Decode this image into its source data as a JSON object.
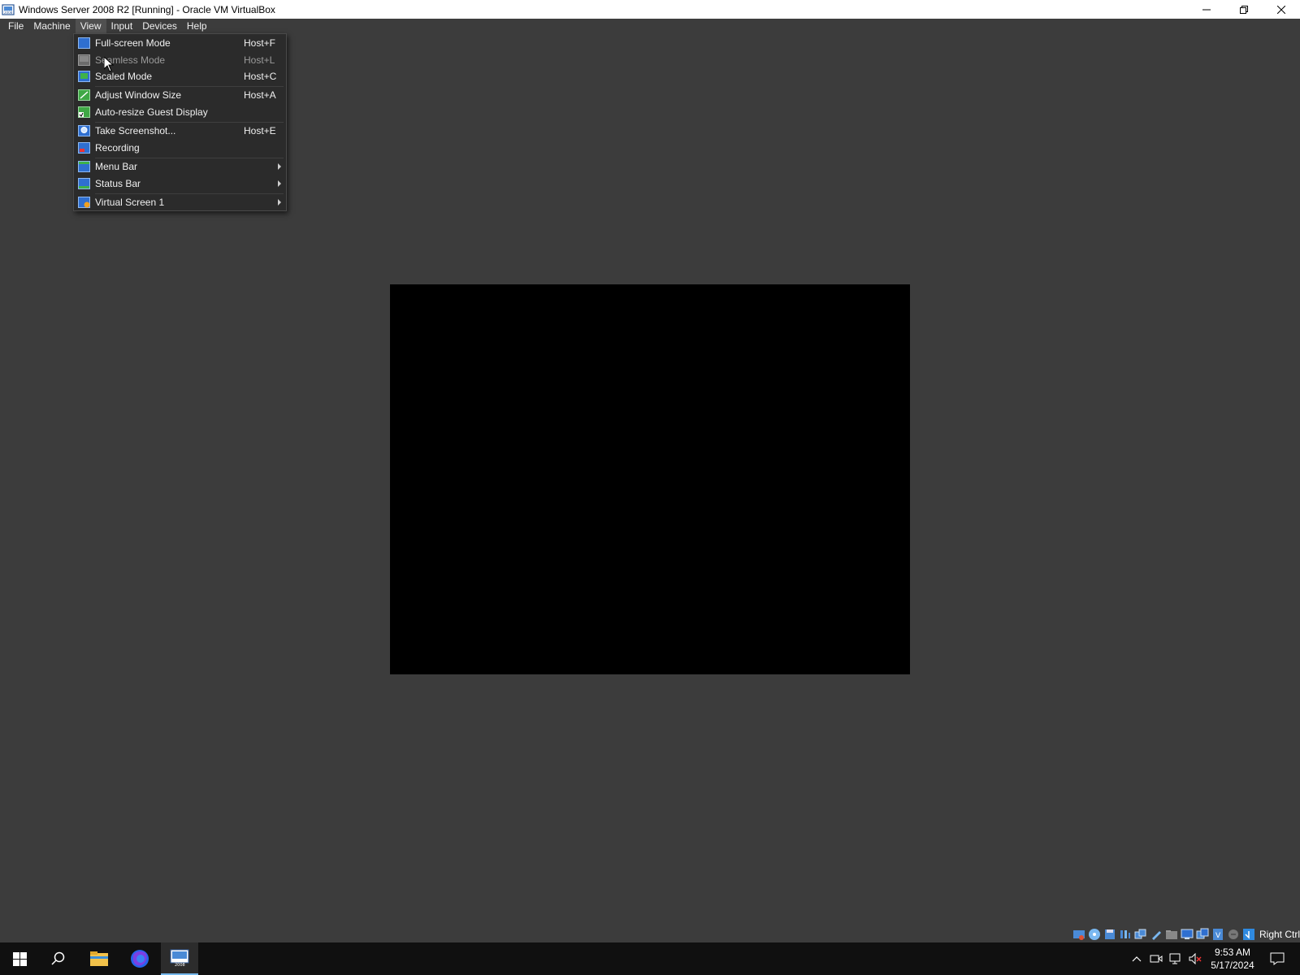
{
  "window": {
    "title": "Windows Server 2008 R2 [Running] - Oracle VM VirtualBox",
    "minimize_icon": "minimize-icon",
    "restore_icon": "restore-icon",
    "close_icon": "close-icon"
  },
  "menubar": {
    "items": [
      {
        "label": "File"
      },
      {
        "label": "Machine"
      },
      {
        "label": "View"
      },
      {
        "label": "Input"
      },
      {
        "label": "Devices"
      },
      {
        "label": "Help"
      }
    ],
    "active": "View"
  },
  "view_menu": {
    "items": [
      {
        "label": "Full-screen Mode",
        "shortcut": "Host+F",
        "icon": "fullscreen-icon",
        "enabled": true
      },
      {
        "label": "Seamless Mode",
        "shortcut": "Host+L",
        "icon": "seamless-icon",
        "enabled": false
      },
      {
        "label": "Scaled Mode",
        "shortcut": "Host+C",
        "icon": "scaled-icon",
        "enabled": true
      },
      {
        "label": "Adjust Window Size",
        "shortcut": "Host+A",
        "icon": "adjust-window-icon",
        "enabled": true
      },
      {
        "label": "Auto-resize Guest Display",
        "shortcut": "",
        "icon": "auto-resize-icon",
        "enabled": true
      },
      {
        "label": "Take Screenshot...",
        "shortcut": "Host+E",
        "icon": "screenshot-icon",
        "enabled": true
      },
      {
        "label": "Recording",
        "shortcut": "",
        "icon": "recording-icon",
        "enabled": true
      },
      {
        "label": "Menu Bar",
        "shortcut": "",
        "icon": "menu-bar-icon",
        "enabled": true,
        "submenu": true
      },
      {
        "label": "Status Bar",
        "shortcut": "",
        "icon": "status-bar-icon",
        "enabled": true,
        "submenu": true
      },
      {
        "label": "Virtual Screen 1",
        "shortcut": "",
        "icon": "virtual-screen-icon",
        "enabled": true,
        "submenu": true
      }
    ]
  },
  "statusbar": {
    "icons": [
      "hard-disk-icon",
      "optical-drive-icon",
      "floppy-icon",
      "audio-icon",
      "network-icon",
      "usb-icon",
      "shared-folders-icon",
      "display-icon",
      "recording-icon",
      "vt-x-icon",
      "mouse-integration-icon",
      "keyboard-icon"
    ],
    "host_key": "Right Ctrl"
  },
  "taskbar": {
    "apps": [
      "start-icon",
      "search-icon",
      "file-explorer-icon",
      "firefox-icon",
      "virtualbox-icon"
    ],
    "tray_icons": [
      "chevron-up-icon",
      "meet-now-icon",
      "network-icon",
      "volume-muted-icon"
    ],
    "time": "9:53 AM",
    "date": "5/17/2024"
  }
}
